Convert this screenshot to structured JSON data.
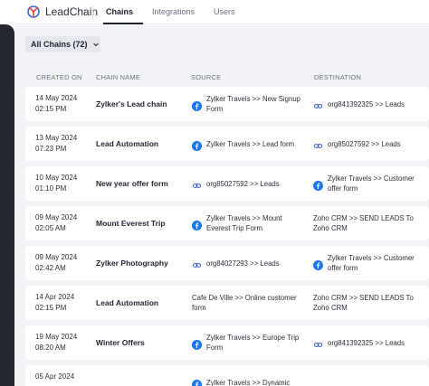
{
  "app": {
    "name": "LeadChain"
  },
  "tabs": [
    {
      "label": "Chains",
      "active": true
    },
    {
      "label": "Integrations",
      "active": false
    },
    {
      "label": "Users",
      "active": false
    }
  ],
  "filter": {
    "label": "All Chains (72)"
  },
  "columns": {
    "created": "CREATED ON",
    "name": "CHAIN NAME",
    "source": "SOURCE",
    "destination": "DESTINATION"
  },
  "rows": [
    {
      "date": "14 May 2024",
      "time": "02:15 PM",
      "name": "Zylker's Lead chain",
      "source": {
        "icon": "facebook-icon",
        "text": "Zylker Travels  >>  New Signup Form"
      },
      "destination": {
        "icon": "webhook-icon",
        "text": "org841392325  >>  Leads"
      }
    },
    {
      "date": "13 May 2024",
      "time": "07:23 PM",
      "name": "Lead Automation",
      "source": {
        "icon": "facebook-icon",
        "text": "Zylker Travels  >>  Lead form"
      },
      "destination": {
        "icon": "webhook-icon",
        "text": "org85027592  >>  Leads"
      }
    },
    {
      "date": "10 May 2024",
      "time": "01:10 PM",
      "name": "New year offer form",
      "source": {
        "icon": "webhook-icon",
        "text": "org85027592  >>  Leads"
      },
      "destination": {
        "icon": "facebook-icon",
        "text": "Zylker Travels  >>  Customer offer form"
      }
    },
    {
      "date": "09 May 2024",
      "time": "02:05 AM",
      "name": "Mount Everest Trip",
      "source": {
        "icon": "facebook-icon",
        "text": "Zylker Travels  >>  Mount Everest Trip Form"
      },
      "destination": {
        "icon": "none",
        "text": "Zoho CRM  >>  SEND LEADS To Zoho CRM"
      }
    },
    {
      "date": "09 May 2024",
      "time": "02:42 AM",
      "name": "Zylker Photography",
      "source": {
        "icon": "webhook-icon",
        "text": "org84027293  >>  Leads"
      },
      "destination": {
        "icon": "facebook-icon",
        "text": "Zylker Travels  >>  Customer offer form"
      }
    },
    {
      "date": "14 Apr 2024",
      "time": "02:15 PM",
      "name": "Lead Automation",
      "source": {
        "icon": "none",
        "text": "Cafe De Ville  >>  Online customer form"
      },
      "destination": {
        "icon": "none",
        "text": "Zoho CRM  >>  SEND LEADS To Zoho CRM"
      }
    },
    {
      "date": "19 May 2024",
      "time": "08:20 AM",
      "name": "Winter Offers",
      "source": {
        "icon": "facebook-icon",
        "text": "Zylker Travels  >>  Europe Trip Form"
      },
      "destination": {
        "icon": "webhook-icon",
        "text": "org841392325  >>  Leads"
      }
    },
    {
      "date": "05 Apr 2024",
      "time": "",
      "name": "",
      "source": {
        "icon": "facebook-icon",
        "text": "Zylker Travels  >>  Dynamic"
      },
      "destination": {
        "icon": "none",
        "text": ""
      }
    }
  ],
  "colors": {
    "facebook": "#1877f2",
    "webhook": "#3c5dd6",
    "brand_red": "#e8433e",
    "brand_blue": "#2f6fd6"
  }
}
